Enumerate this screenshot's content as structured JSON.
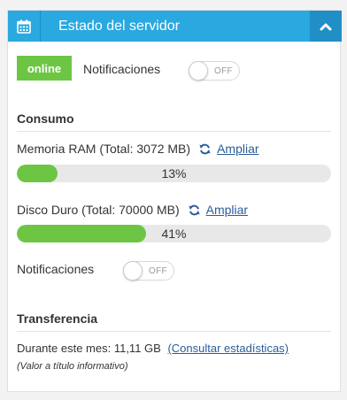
{
  "header": {
    "title": "Estado del servidor",
    "calendar_icon": "calendar-icon",
    "collapse_icon": "chevron-up-icon",
    "background": "#2aa8e0"
  },
  "status": {
    "badge": "online",
    "badge_color": "#6cc644",
    "notifications_label": "Notificaciones",
    "notifications_toggle": "OFF"
  },
  "consumo": {
    "title": "Consumo",
    "ram": {
      "label": "Memoria RAM (Total: 3072 MB)",
      "link": "Ampliar",
      "percent": 13,
      "percent_label": "13%"
    },
    "disk": {
      "label": "Disco Duro (Total: 70000 MB)",
      "link": "Ampliar",
      "percent": 41,
      "percent_label": "41%"
    },
    "notifications_label": "Notificaciones",
    "notifications_toggle": "OFF"
  },
  "transferencia": {
    "title": "Transferencia",
    "month_label": "Durante este mes: 11,11 GB",
    "stats_link": "(Consultar estadísticas)",
    "note": "(Valor a título informativo)"
  }
}
